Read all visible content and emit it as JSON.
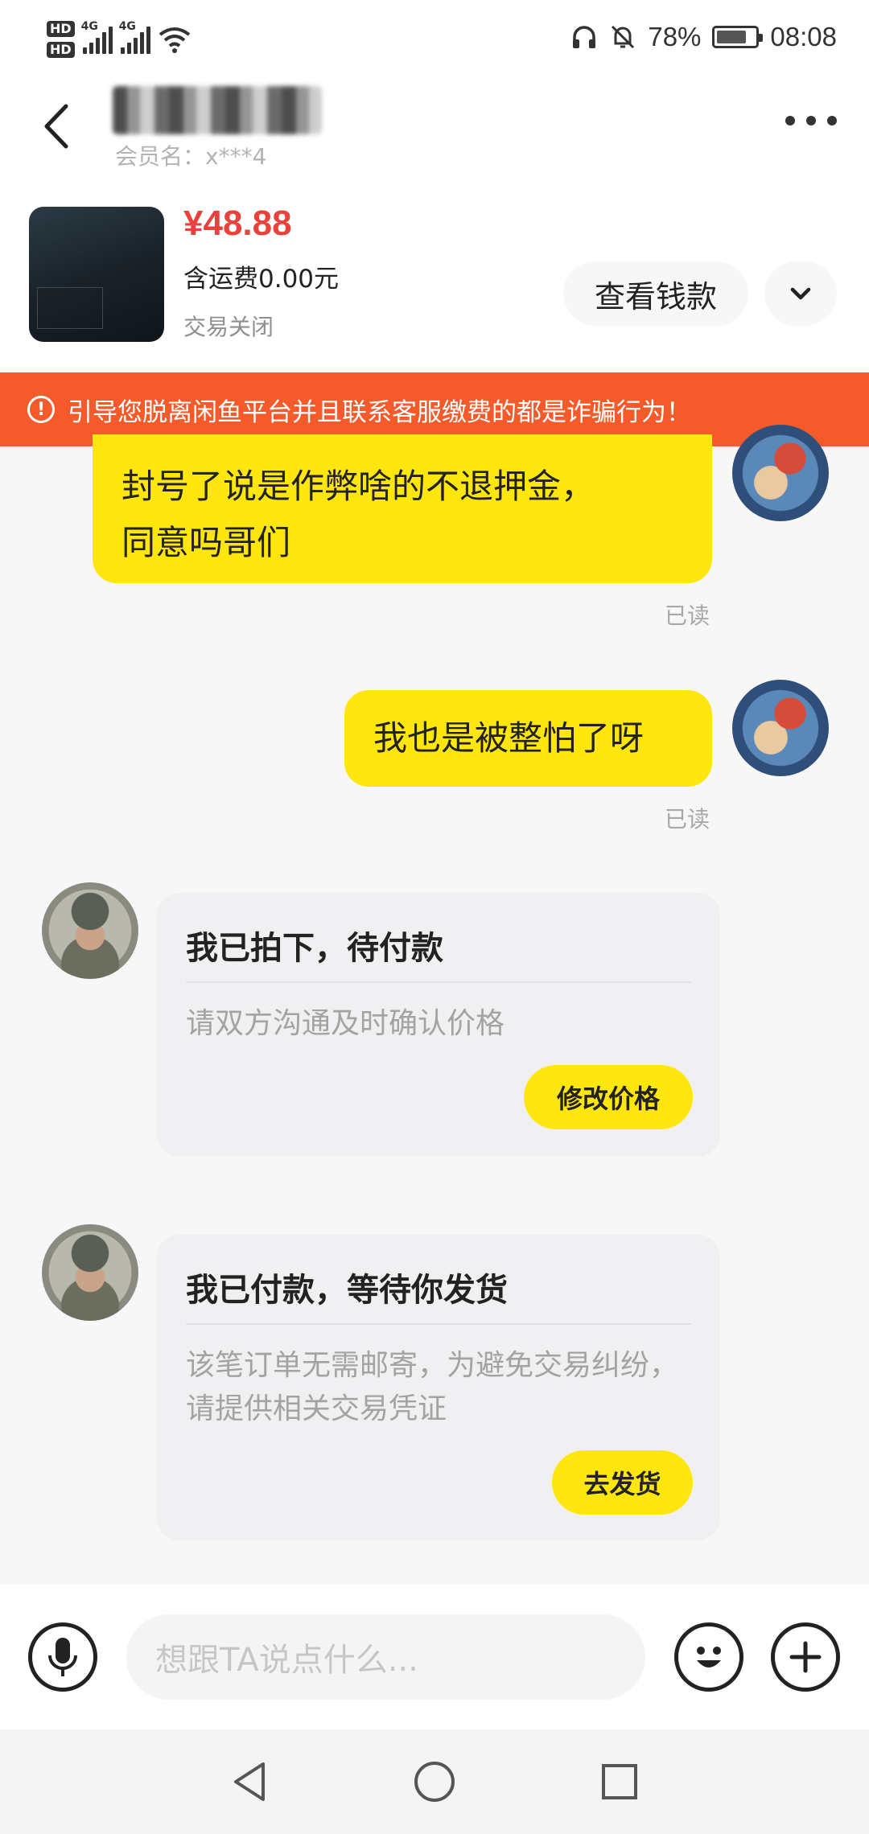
{
  "status_bar": {
    "hd1": "HD",
    "hd2": "HD",
    "net1": "4G",
    "net2": "4G",
    "battery": "78%",
    "time": "08:08",
    "battery_level": 0.78
  },
  "header": {
    "member": "会员名：x***4"
  },
  "product": {
    "price": "¥48.88",
    "shipping": "含运费0.00元",
    "status": "交易关闭",
    "view_money": "查看钱款"
  },
  "warning": {
    "icon": "!",
    "text": "引导您脱离闲鱼平台并且联系客服缴费的都是诈骗行为！"
  },
  "messages": [
    {
      "text_line1": "封号了说是作弊啥的不退押金，",
      "text_line2": "同意吗哥们",
      "status": "已读"
    },
    {
      "text": "我也是被整怕了呀",
      "status": "已读"
    }
  ],
  "cards": [
    {
      "title": "我已拍下，待付款",
      "desc": "请双方沟通及时确认价格",
      "button": "修改价格"
    },
    {
      "title": "我已付款，等待你发货",
      "desc": "该笔订单无需邮寄，为避免交易纠纷，请提供相关交易凭证",
      "button": "去发货"
    }
  ],
  "input": {
    "placeholder": "想跟TA说点什么..."
  },
  "icons": {
    "back": "back-arrow-icon",
    "more": "more-icon",
    "expand": "chevron-down-icon",
    "mic": "microphone-icon",
    "emoji": "emoji-icon",
    "add": "plus-icon"
  },
  "colors": {
    "accent": "#ffe60f",
    "price": "#e9413b",
    "warning": "#f45a2a"
  }
}
